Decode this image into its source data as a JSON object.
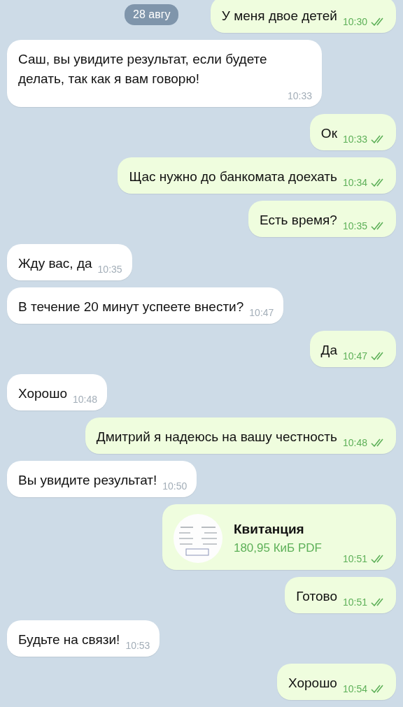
{
  "date_pill": "28 авгу",
  "messages": [
    {
      "kind": "text",
      "outgoing": true,
      "text": "У меня двое детей",
      "time": "10:30"
    },
    {
      "kind": "text",
      "outgoing": false,
      "text": "Саш, вы увидите результат, если будете делать, так как я вам говорю!",
      "time": "10:33"
    },
    {
      "kind": "text",
      "outgoing": true,
      "text": "Ок",
      "time": "10:33"
    },
    {
      "kind": "text",
      "outgoing": true,
      "text": "Щас нужно до банкомата доехать",
      "time": "10:34"
    },
    {
      "kind": "text",
      "outgoing": true,
      "text": "Есть время?",
      "time": "10:35"
    },
    {
      "kind": "text",
      "outgoing": false,
      "text": "Жду вас, да",
      "time": "10:35"
    },
    {
      "kind": "text",
      "outgoing": false,
      "text": "В течение 20 минут успеете внести?",
      "time": "10:47"
    },
    {
      "kind": "text",
      "outgoing": true,
      "text": "Да",
      "time": "10:47"
    },
    {
      "kind": "text",
      "outgoing": false,
      "text": "Хорошо",
      "time": "10:48"
    },
    {
      "kind": "text",
      "outgoing": true,
      "text": "Дмитрий я надеюсь на вашу честность",
      "time": "10:48"
    },
    {
      "kind": "text",
      "outgoing": false,
      "text": "Вы увидите результат!",
      "time": "10:50"
    },
    {
      "kind": "file",
      "outgoing": true,
      "name": "Квитанция",
      "size": "180,95 КиБ PDF",
      "time": "10:51"
    },
    {
      "kind": "text",
      "outgoing": true,
      "text": "Готово",
      "time": "10:51"
    },
    {
      "kind": "text",
      "outgoing": false,
      "text": "Будьте на связи!",
      "time": "10:53"
    },
    {
      "kind": "text",
      "outgoing": true,
      "text": "Хорошо",
      "time": "10:54"
    }
  ]
}
